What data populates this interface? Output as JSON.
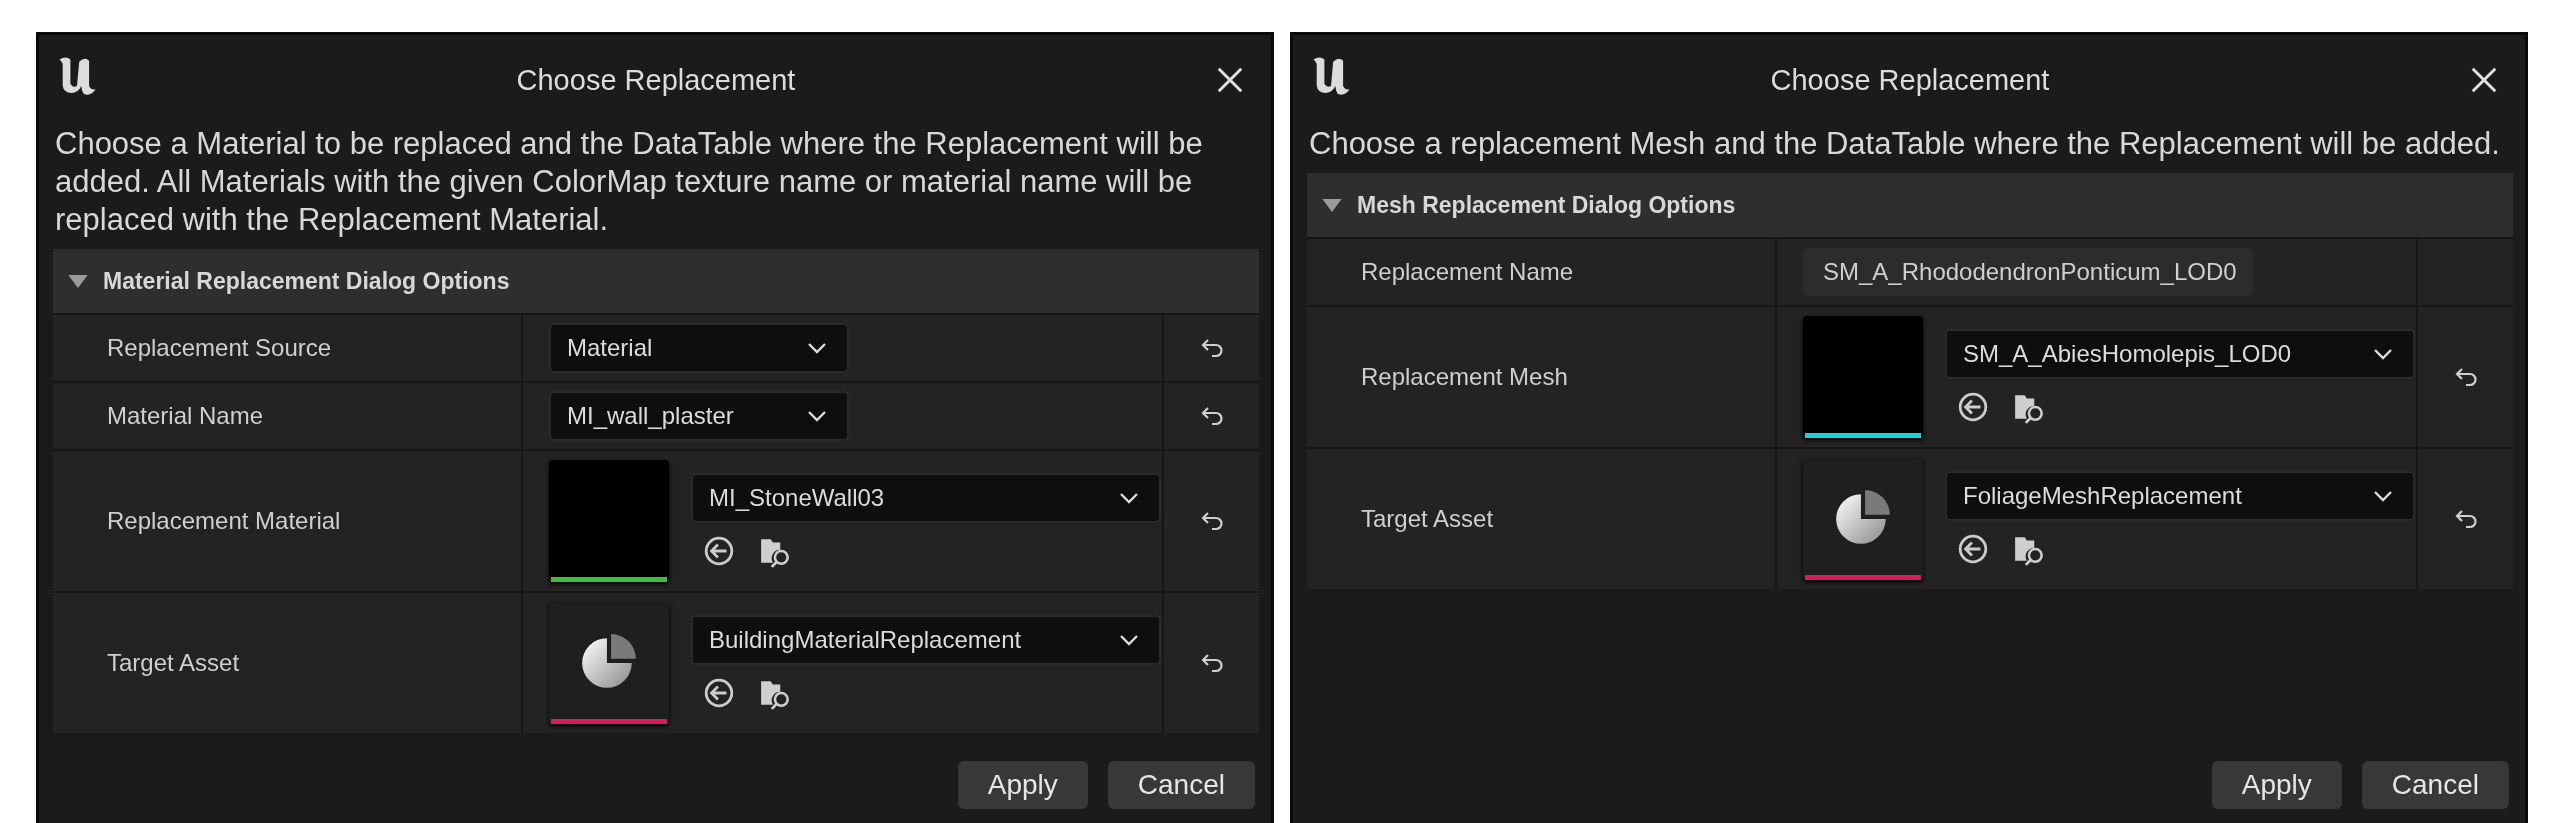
{
  "dialogs": [
    {
      "title": "Choose Replacement",
      "description": "Choose a Material to be replaced and the DataTable where the Replacement will be added. All Materials with the given ColorMap texture name or material name will be replaced with the Replacement Material.",
      "section": {
        "title": "Material Replacement Dialog Options",
        "expanded": true
      },
      "rows": [
        {
          "kind": "dropdown",
          "label": "Replacement Source",
          "value": "Material",
          "reset": true
        },
        {
          "kind": "dropdown",
          "label": "Material Name",
          "value": "MI_wall_plaster",
          "reset": true
        },
        {
          "kind": "asset",
          "label": "Replacement Material",
          "value": "MI_StoneWall03",
          "thumbnail_icon": false,
          "color": "#3fbf3f",
          "reset": true
        },
        {
          "kind": "asset",
          "label": "Target Asset",
          "value": "BuildingMaterialReplacement",
          "thumbnail_icon": true,
          "color": "#d81b5a",
          "reset": true
        }
      ],
      "buttons": [
        "Apply",
        "Cancel"
      ]
    },
    {
      "title": "Choose Replacement",
      "description": "Choose a replacement Mesh and the DataTable where the Replacement will be added.",
      "section": {
        "title": "Mesh Replacement Dialog Options",
        "expanded": true
      },
      "rows": [
        {
          "kind": "text",
          "label": "Replacement Name",
          "value": "SM_A_RhododendronPonticum_LOD0",
          "reset": false
        },
        {
          "kind": "asset",
          "label": "Replacement Mesh",
          "value": "SM_A_AbiesHomolepis_LOD0",
          "thumbnail_icon": false,
          "color": "#19d3d8",
          "reset": true
        },
        {
          "kind": "asset",
          "label": "Target Asset",
          "value": "FoliageMeshReplacement",
          "thumbnail_icon": true,
          "color": "#d81b5a",
          "reset": true
        }
      ],
      "buttons": [
        "Apply",
        "Cancel"
      ]
    }
  ]
}
